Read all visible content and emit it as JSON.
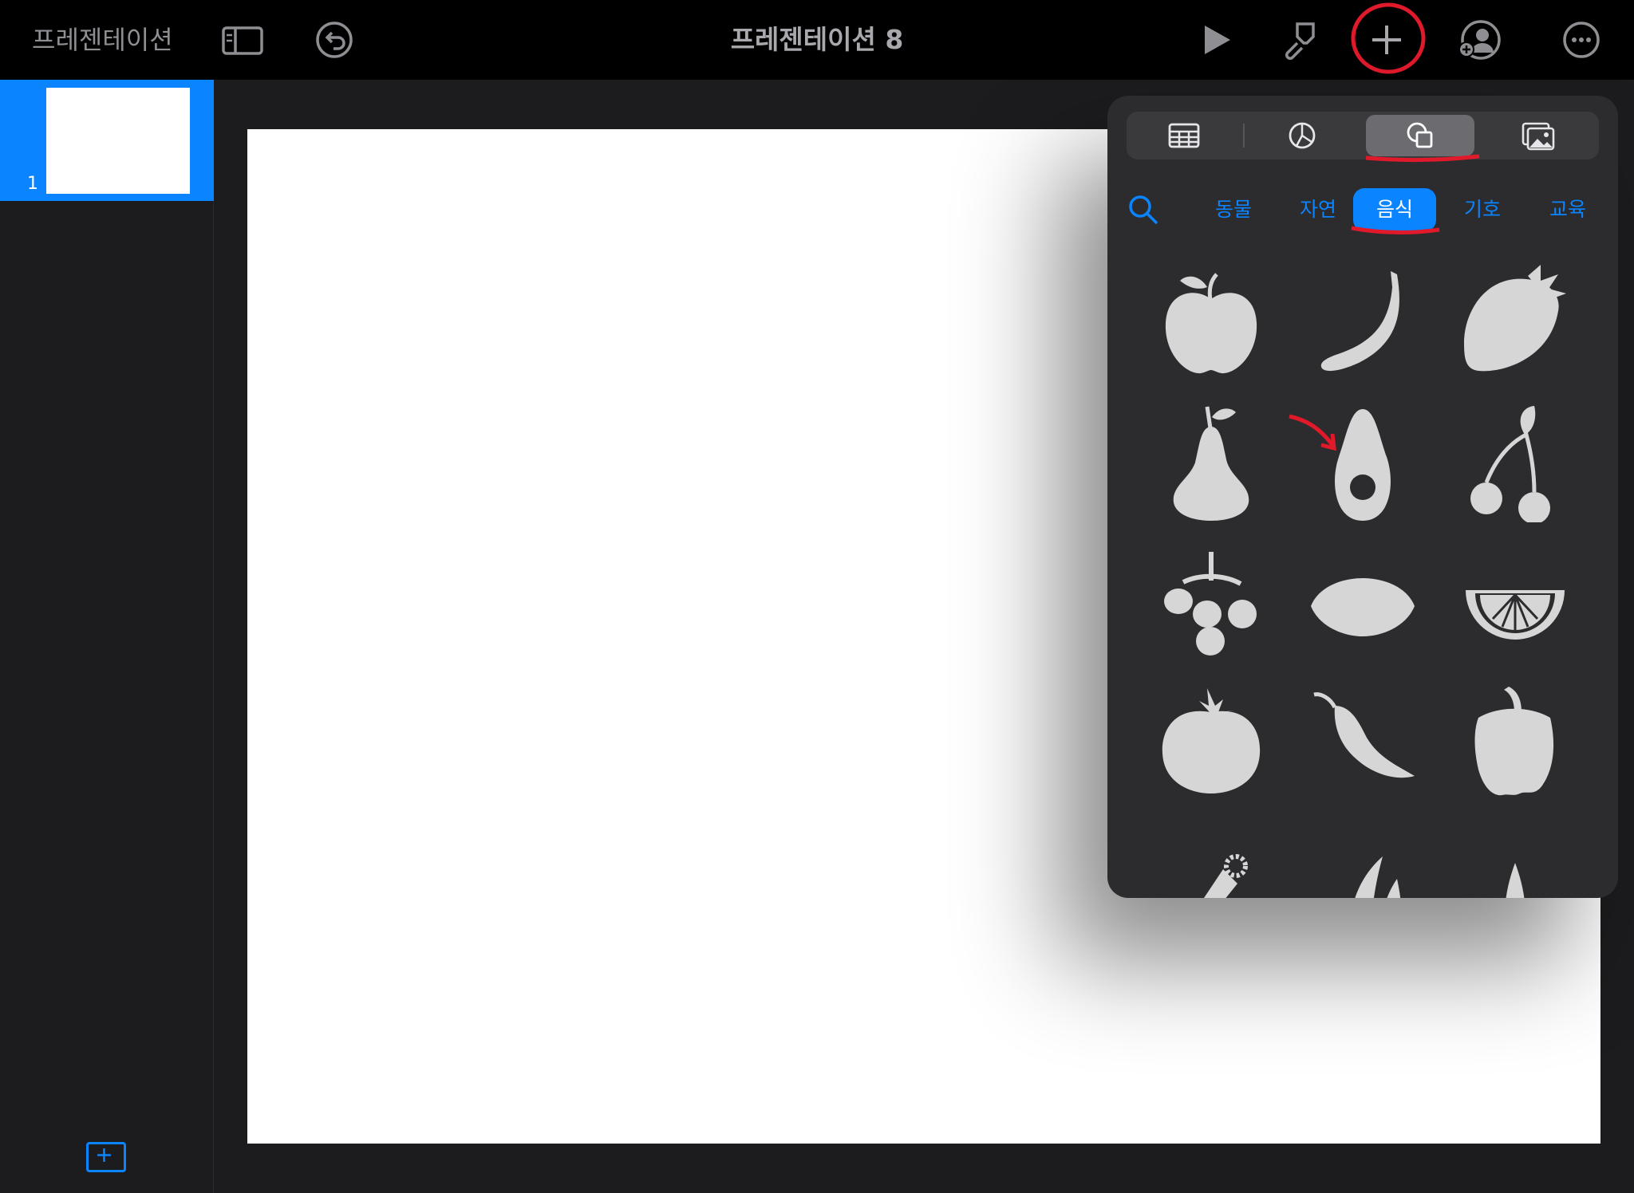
{
  "toolbar": {
    "back_label": "프레젠테이션",
    "document_title": "프레젠테이션 8",
    "icons": [
      "sidebar-icon",
      "undo-icon",
      "play-icon",
      "paintbrush-icon",
      "plus-icon",
      "collaborate-icon",
      "more-icon"
    ]
  },
  "sidebar": {
    "slides": [
      {
        "number": "1"
      }
    ],
    "add_slide_icon": "plus-square-icon"
  },
  "insert_popover": {
    "tabs": [
      {
        "name": "table",
        "icon": "table-icon"
      },
      {
        "name": "chart",
        "icon": "pie-chart-icon"
      },
      {
        "name": "shape",
        "icon": "shapes-icon",
        "selected": true
      },
      {
        "name": "media",
        "icon": "photo-icon"
      }
    ],
    "categories": [
      {
        "label": "동물"
      },
      {
        "label": "자연"
      },
      {
        "label": "음식",
        "selected": true
      },
      {
        "label": "기호"
      },
      {
        "label": "교육"
      }
    ],
    "shapes": [
      "apple-icon",
      "banana-icon",
      "strawberry-icon",
      "pear-icon",
      "avocado-icon",
      "cherries-icon",
      "grapes-icon",
      "lemon-icon",
      "citrus-slice-icon",
      "tomato-icon",
      "chili-pepper-icon",
      "bell-pepper-icon",
      "carrot-icon",
      "green-beans-icon",
      "corn-icon"
    ]
  },
  "colors": {
    "accent": "#0a84ff",
    "toolbar_bg": "#000000",
    "panel_bg": "#2c2c2e",
    "shape_fill": "#d6d6d6",
    "annotation": "#e0192b"
  }
}
